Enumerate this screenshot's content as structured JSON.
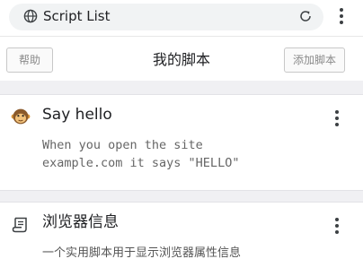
{
  "browser": {
    "address_text": "Script List",
    "icons": {
      "site": "globe-icon",
      "reload": "reload-icon",
      "menu": "more-vert-icon"
    }
  },
  "header": {
    "left_button": "帮助",
    "title": "我的脚本",
    "right_button": "添加脚本"
  },
  "scripts": [
    {
      "icon": "monkey-icon",
      "title": "Say hello",
      "description_lines": [
        "When you open the site",
        "example.com it says \"HELLO\""
      ],
      "menu_icon": "more-vert-icon"
    },
    {
      "icon": "scroll-document-icon",
      "title": "浏览器信息",
      "description": "一个实用脚本用于显示浏览器属性信息",
      "menu_icon": "more-vert-icon"
    }
  ],
  "colors": {
    "address_pill": "#f1f3f4",
    "separator": "#f0f0f3",
    "button_border": "#c8c8c8",
    "monkey": "#e0a040"
  }
}
